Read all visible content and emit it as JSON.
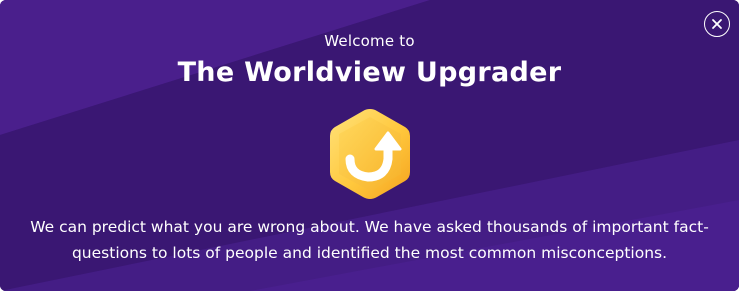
{
  "modal": {
    "welcome_label": "Welcome to",
    "title": "The Worldview Upgrader",
    "badge_icon": "upgrade-arrow-hexagon-icon",
    "description": "We can predict what you are wrong about. We have asked thousands of important fact-questions to lots of people and identified the most common misconceptions.",
    "close_icon": "close-icon"
  },
  "colors": {
    "background": "#3b1873",
    "background_light": "#4a1f8c",
    "text": "#ffffff",
    "badge_yellow": "#ffd24a",
    "badge_orange": "#f5a623"
  }
}
